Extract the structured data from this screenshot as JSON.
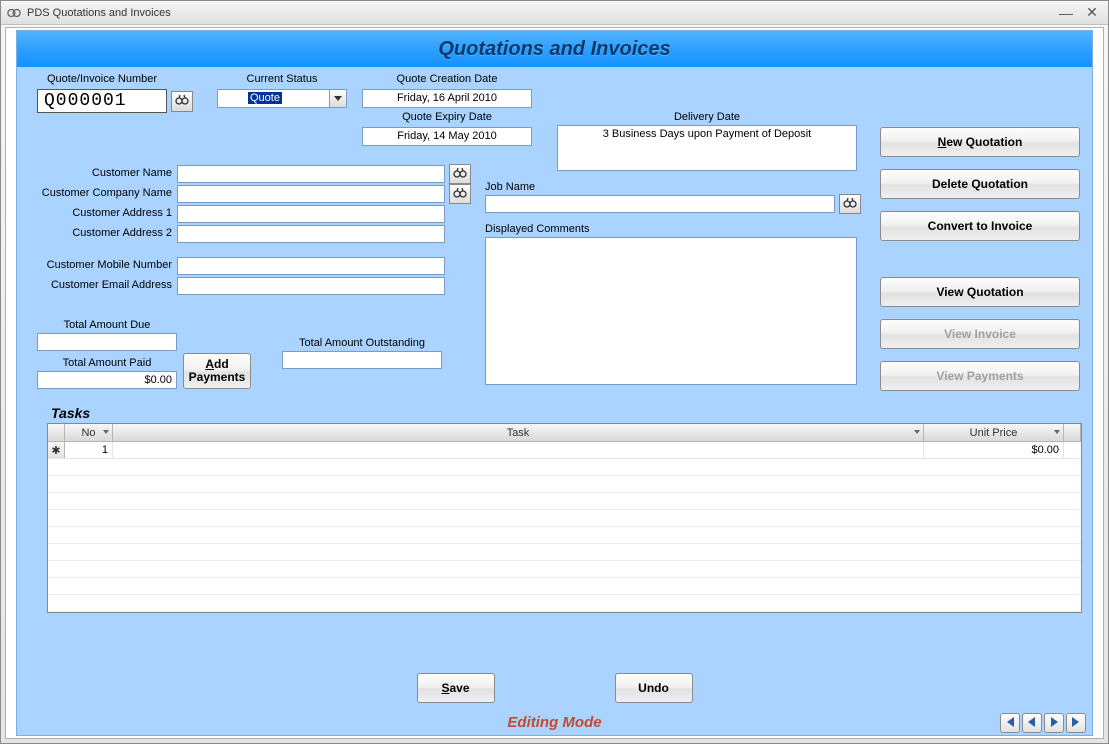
{
  "window": {
    "title": "PDS Quotations and Invoices"
  },
  "header": {
    "title": "Quotations and Invoices"
  },
  "labels": {
    "quote_number": "Quote/Invoice Number",
    "current_status": "Current Status",
    "quote_creation": "Quote Creation Date",
    "quote_expiry": "Quote Expiry Date",
    "delivery_date": "Delivery Date",
    "customer_name": "Customer Name",
    "company_name": "Customer Company Name",
    "address1": "Customer Address 1",
    "address2": "Customer Address 2",
    "mobile": "Customer Mobile Number",
    "email": "Customer Email Address",
    "job_name": "Job Name",
    "displayed_comments": "Displayed Comments",
    "total_due": "Total Amount Due",
    "total_paid": "Total Amount Paid",
    "total_outstanding": "Total Amount Outstanding",
    "tasks": "Tasks"
  },
  "values": {
    "quote_number": "Q000001",
    "status": "Quote",
    "creation_date": "Friday, 16 April 2010",
    "expiry_date": "Friday, 14 May 2010",
    "delivery": "3 Business Days upon Payment of Deposit",
    "customer_name": "",
    "company_name": "",
    "address1": "",
    "address2": "",
    "mobile": "",
    "email": "",
    "job_name": "",
    "comments": "",
    "total_due": "",
    "total_paid": "$0.00",
    "total_outstanding": ""
  },
  "buttons": {
    "new_quote_u": "N",
    "new_quote_rest": "ew Quotation",
    "delete_quote": "Delete Quotation",
    "convert": "Convert to Invoice",
    "view_quote": "View Quotation",
    "view_invoice": "View Invoice",
    "view_payments": "View Payments",
    "add_u": "A",
    "add_rest": "dd",
    "add_line2": "Payments",
    "save_u": "S",
    "save_rest": "ave",
    "undo": "Undo"
  },
  "grid": {
    "headers": {
      "no": "No",
      "task": "Task",
      "unit_price": "Unit Price"
    },
    "rows": [
      {
        "no": "1",
        "task": "",
        "unit_price": "$0.00"
      }
    ]
  },
  "mode": "Editing Mode"
}
